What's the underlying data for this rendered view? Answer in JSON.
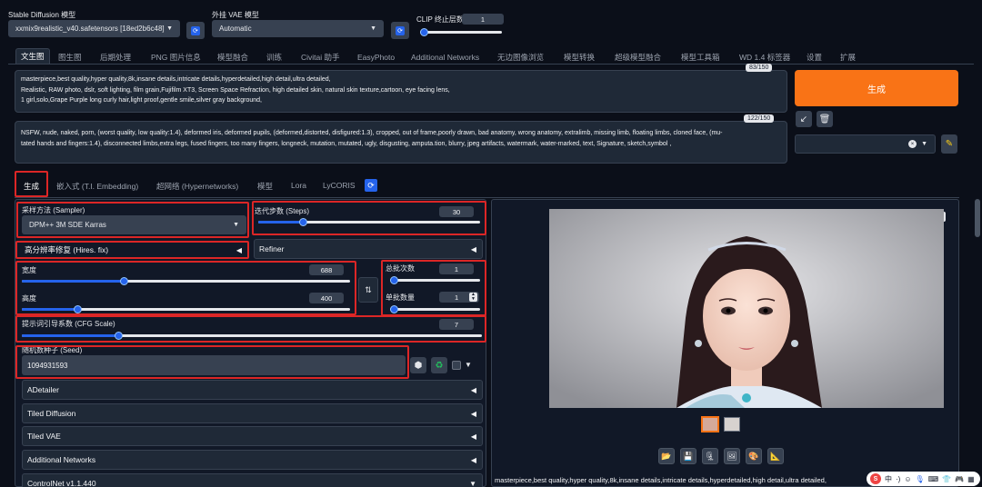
{
  "header": {
    "model_label": "Stable Diffusion 模型",
    "model_value": "xxmix9realistic_v40.safetensors [18ed2b6c48]",
    "vae_label": "外挂 VAE 模型",
    "vae_value": "Automatic",
    "clip_label": "CLIP 终止层数",
    "clip_value": "1",
    "clip_fraction": 0.0
  },
  "tabs": [
    "文生图",
    "图生图",
    "后期处理",
    "PNG 图片信息",
    "模型融合",
    "训练",
    "Civitai 助手",
    "EasyPhoto",
    "Additional Networks",
    "无边图像浏览",
    "模型转换",
    "超级模型融合",
    "模型工具箱",
    "WD 1.4 标签器",
    "设置",
    "扩展"
  ],
  "prompt": {
    "positive_line1": "masterpiece,best quality,hyper quality,8k,insane details,intricate details,hyperdetailed,high detail,ultra detailed,",
    "positive_line2": "Realistic, RAW photo, dslr, soft lighting, film grain,Fujifilm XT3, Screen Space Refraction, high detailed skin, natural skin texture,cartoon, eye facing lens,",
    "positive_line3": "1 girl,solo,Grape Purple long curly hair,light proof,gentle smile,silver gray background,",
    "positive_counter": "83/150",
    "negative_line1": "NSFW, nude, naked, porn, (worst quality, low quality:1.4), deformed iris, deformed pupils, (deformed,distorted, disfigured:1.3), cropped, out of frame,poorly drawn, bad anatomy, wrong anatomy, extralimb, missing limb, floating limbs, cloned face, (mu-",
    "negative_line2": "tated hands and fingers:1.4), disconnected limbs,extra legs, fused fingers, too many fingers, longneck, mutation, mutated, ugly, disgusting, amputa.tion, blurry, jpeg artifacts, watermark, water-marked, text, Signature, sketch,symbol ,",
    "negative_counter": "122/150"
  },
  "generate_button": "生成",
  "subtabs": [
    "生成",
    "嵌入式 (T.I. Embedding)",
    "超网络 (Hypernetworks)",
    "模型",
    "Lora",
    "LyCORIS"
  ],
  "sampler": {
    "label": "采样方法 (Sampler)",
    "value": "DPM++ 3M SDE Karras"
  },
  "steps": {
    "label": "迭代步数 (Steps)",
    "value": "30",
    "fraction": 0.2
  },
  "hires": {
    "label": "高分辨率修复 (Hires. fix)"
  },
  "refiner": {
    "label": "Refiner"
  },
  "width": {
    "label": "宽度",
    "value": "688",
    "fraction": 0.31
  },
  "height": {
    "label": "高度",
    "value": "400",
    "fraction": 0.17
  },
  "batch_count": {
    "label": "总批次数",
    "value": "1",
    "fraction": 0.0
  },
  "batch_size": {
    "label": "单批数量",
    "value": "1",
    "fraction": 0.0
  },
  "cfg": {
    "label": "提示词引导系数 (CFG Scale)",
    "value": "7",
    "fraction": 0.21
  },
  "seed": {
    "label": "随机数种子 (Seed)",
    "value": "1094931593"
  },
  "accordions": [
    "ADetailer",
    "Tiled Diffusion",
    "Tiled VAE",
    "Additional Networks",
    "ControlNet v1.1.440"
  ],
  "output_caption": "masterpiece,best quality,hyper quality,8k,insane details,intricate details,hyperdetailed,high detail,ultra detailed,",
  "colors": {
    "accent_orange": "#f97316",
    "highlight_red": "#dc2626",
    "slider_blue": "#2563eb"
  }
}
